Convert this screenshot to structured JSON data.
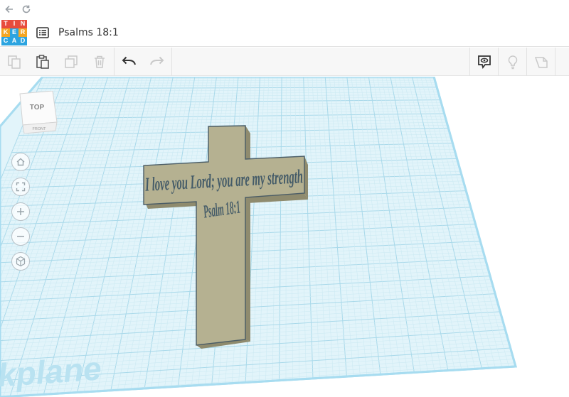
{
  "browser": {
    "back_icon": "arrow-left-icon",
    "reload_icon": "reload-icon"
  },
  "logo": {
    "letters": [
      "T",
      "I",
      "N",
      "K",
      "E",
      "R",
      "C",
      "A",
      "D"
    ],
    "colors": [
      "#e84c3d",
      "#e84c3d",
      "#e84c3d",
      "#f5a623",
      "#2ca4e0",
      "#f5a623",
      "#2ca4e0",
      "#2ca4e0",
      "#2ca4e0"
    ]
  },
  "header": {
    "menu_icon": "list-icon",
    "design_title": "Psalms 18:1"
  },
  "toolbar": {
    "left_tools": [
      "copy-icon",
      "paste-icon",
      "duplicate-icon",
      "delete-icon",
      "undo-icon",
      "redo-icon"
    ],
    "right_tools": [
      "notes-icon",
      "lightbulb-icon",
      "shape-icon"
    ]
  },
  "viewcube": {
    "top_label": "TOP",
    "front_label": "FRONT"
  },
  "nav_controls": [
    "home-view-icon",
    "fit-all-icon",
    "zoom-in-icon",
    "zoom-out-icon",
    "perspective-icon"
  ],
  "workplane": {
    "label": "Workplane",
    "visible_text": "rkplane"
  },
  "model": {
    "line1": "I love you Lord; you are my strength",
    "line2": "Psalm 18:1",
    "face_color": "#b5b191",
    "side_color": "#8f8b6e",
    "text_color": "#445b68"
  },
  "colors": {
    "grid_fine": "#cdeaf3",
    "grid_major": "#a9d9ea",
    "plane_fill": "#e2f4fa",
    "plane_border": "#a7dcf0"
  }
}
